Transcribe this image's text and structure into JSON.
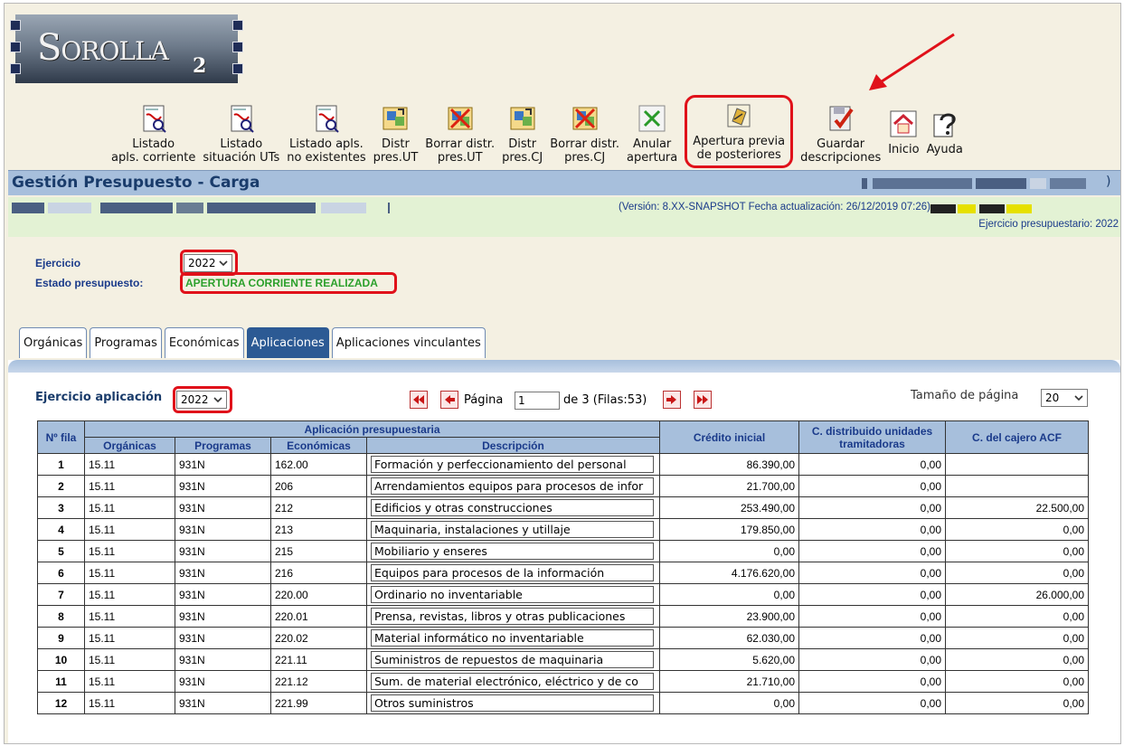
{
  "app": {
    "logo_text": "Sorolla",
    "logo_sub": "2"
  },
  "toolbar": [
    {
      "name": "listado-apls-corriente-button",
      "icon": "pdf-report-icon",
      "line1": "Listado",
      "line2": "apls. corriente"
    },
    {
      "name": "listado-situacion-uts-button",
      "icon": "pdf-report-icon",
      "line1": "Listado",
      "line2": "situación UTs"
    },
    {
      "name": "listado-apls-no-existentes-button",
      "icon": "pdf-report-icon",
      "line1": "Listado apls.",
      "line2": "no existentes"
    },
    {
      "name": "distr-pres-ut-button",
      "icon": "distribute-icon",
      "line1": "Distr",
      "line2": "pres.UT"
    },
    {
      "name": "borrar-distr-pres-ut-button",
      "icon": "delete-distribution-icon",
      "line1": "Borrar distr.",
      "line2": "pres.UT"
    },
    {
      "name": "distr-pres-cj-button",
      "icon": "distribute-icon",
      "line1": "Distr",
      "line2": "pres.CJ"
    },
    {
      "name": "borrar-distr-pres-cj-button",
      "icon": "delete-distribution-icon",
      "line1": "Borrar distr.",
      "line2": "pres.CJ"
    },
    {
      "name": "anular-apertura-button",
      "icon": "cancel-x-icon",
      "line1": "Anular",
      "line2": "apertura"
    },
    {
      "name": "apertura-previa-button",
      "icon": "open-folder-icon",
      "line1": "Apertura previa",
      "line2": "de posteriores"
    },
    {
      "name": "guardar-descripciones-button",
      "icon": "save-check-icon",
      "line1": "Guardar",
      "line2": "descripciones"
    },
    {
      "name": "inicio-button",
      "icon": "home-icon",
      "line1": "",
      "line2": "Inicio"
    },
    {
      "name": "ayuda-button",
      "icon": "help-icon",
      "line1": "",
      "line2": "Ayuda"
    }
  ],
  "header": {
    "title": "Gestión Presupuesto - Carga",
    "close_paren": ")",
    "version": "(Versión: 8.XX-SNAPSHOT Fecha actualización: 26/12/2019 07:26)",
    "ejercicio_presupuestario": "Ejercicio presupuestario: 2022"
  },
  "filters": {
    "ejercicio_label": "Ejercicio",
    "ejercicio_value": "2022",
    "estado_label": "Estado presupuesto:",
    "estado_value": "APERTURA CORRIENTE REALIZADA"
  },
  "tabs": [
    {
      "label": "Orgánicas",
      "active": false
    },
    {
      "label": "Programas",
      "active": false
    },
    {
      "label": "Económicas",
      "active": false
    },
    {
      "label": "Aplicaciones",
      "active": true
    },
    {
      "label": "Aplicaciones vinculantes",
      "active": false
    }
  ],
  "panel": {
    "ejercicio_aplicacion_label": "Ejercicio aplicación",
    "ejercicio_aplicacion_value": "2022",
    "pagina_label": "Página",
    "pagina_value": "1",
    "pagina_total": "de 3 (Filas:53)",
    "tamano_label": "Tamaño de página",
    "tamano_value": "20"
  },
  "table": {
    "headers": {
      "nfila": "Nº fila",
      "aplicacion": "Aplicación presupuestaria",
      "organicas": "Orgánicas",
      "programas": "Programas",
      "economicas": "Económicas",
      "descripcion": "Descripción",
      "credito": "Crédito inicial",
      "distribuido": "C. distribuido unidades tramitadoras",
      "cajero": "C. del cajero ACF"
    },
    "rows": [
      [
        "1",
        "15.11",
        "931N",
        "162.00",
        "Formación y perfeccionamiento del personal",
        "86.390,00",
        "0,00",
        ""
      ],
      [
        "2",
        "15.11",
        "931N",
        "206",
        "Arrendamientos equipos para procesos de infor",
        "21.700,00",
        "0,00",
        ""
      ],
      [
        "3",
        "15.11",
        "931N",
        "212",
        "Edificios y otras construcciones",
        "253.490,00",
        "0,00",
        "22.500,00"
      ],
      [
        "4",
        "15.11",
        "931N",
        "213",
        "Maquinaria, instalaciones y utillaje",
        "179.850,00",
        "0,00",
        "0,00"
      ],
      [
        "5",
        "15.11",
        "931N",
        "215",
        "Mobiliario y enseres",
        "0,00",
        "0,00",
        "0,00"
      ],
      [
        "6",
        "15.11",
        "931N",
        "216",
        "Equipos para procesos de la información",
        "4.176.620,00",
        "0,00",
        "0,00"
      ],
      [
        "7",
        "15.11",
        "931N",
        "220.00",
        "Ordinario no inventariable",
        "0,00",
        "0,00",
        "26.000,00"
      ],
      [
        "8",
        "15.11",
        "931N",
        "220.01",
        "Prensa, revistas, libros y otras publicaciones",
        "23.900,00",
        "0,00",
        "0,00"
      ],
      [
        "9",
        "15.11",
        "931N",
        "220.02",
        "Material informático no inventariable",
        "62.030,00",
        "0,00",
        "0,00"
      ],
      [
        "10",
        "15.11",
        "931N",
        "221.11",
        "Suministros de repuestos de maquinaria",
        "5.620,00",
        "0,00",
        "0,00"
      ],
      [
        "11",
        "15.11",
        "931N",
        "221.12",
        "Sum. de material electrónico, eléctrico y de co",
        "21.710,00",
        "0,00",
        "0,00"
      ],
      [
        "12",
        "15.11",
        "931N",
        "221.99",
        "Otros suministros",
        "0,00",
        "0,00",
        "0,00"
      ]
    ]
  },
  "colors": {
    "highlight": "#e0111a",
    "title_bar": "#a7bfdc",
    "active_tab": "#2c5a94",
    "status_green": "#2ca02c"
  }
}
